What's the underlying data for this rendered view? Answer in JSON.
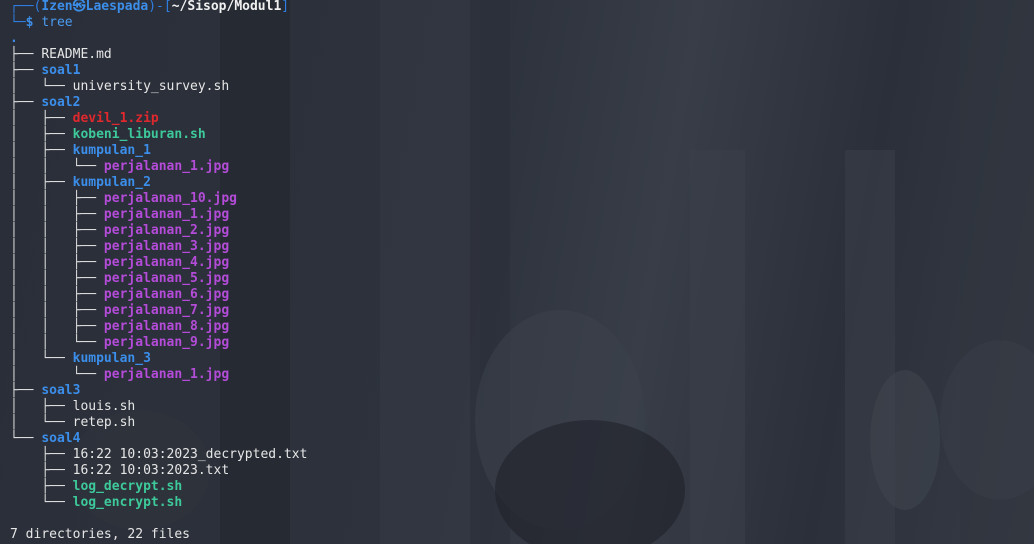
{
  "prompt": {
    "frame_top": "┌──(",
    "user": "Izen㉿Laespada",
    "mid": ")-[",
    "path": "~/Sisop/Modul1",
    "end": "]",
    "frame_bottom": "└─",
    "dollar": "$",
    "command": "tree"
  },
  "tree_root": ".",
  "entries": [
    {
      "prefix": "├── ",
      "name": "README.md",
      "type": "file"
    },
    {
      "prefix": "├── ",
      "name": "soal1",
      "type": "dir"
    },
    {
      "prefix": "│   └── ",
      "name": "university_survey.sh",
      "type": "file"
    },
    {
      "prefix": "├── ",
      "name": "soal2",
      "type": "dir"
    },
    {
      "prefix": "│   ├── ",
      "name": "devil_1.zip",
      "type": "zip"
    },
    {
      "prefix": "│   ├── ",
      "name": "kobeni_liburan.sh",
      "type": "exec"
    },
    {
      "prefix": "│   ├── ",
      "name": "kumpulan_1",
      "type": "dir"
    },
    {
      "prefix": "│   │   └── ",
      "name": "perjalanan_1.jpg",
      "type": "image"
    },
    {
      "prefix": "│   ├── ",
      "name": "kumpulan_2",
      "type": "dir"
    },
    {
      "prefix": "│   │   ├── ",
      "name": "perjalanan_10.jpg",
      "type": "image"
    },
    {
      "prefix": "│   │   ├── ",
      "name": "perjalanan_1.jpg",
      "type": "image"
    },
    {
      "prefix": "│   │   ├── ",
      "name": "perjalanan_2.jpg",
      "type": "image"
    },
    {
      "prefix": "│   │   ├── ",
      "name": "perjalanan_3.jpg",
      "type": "image"
    },
    {
      "prefix": "│   │   ├── ",
      "name": "perjalanan_4.jpg",
      "type": "image"
    },
    {
      "prefix": "│   │   ├── ",
      "name": "perjalanan_5.jpg",
      "type": "image"
    },
    {
      "prefix": "│   │   ├── ",
      "name": "perjalanan_6.jpg",
      "type": "image"
    },
    {
      "prefix": "│   │   ├── ",
      "name": "perjalanan_7.jpg",
      "type": "image"
    },
    {
      "prefix": "│   │   ├── ",
      "name": "perjalanan_8.jpg",
      "type": "image"
    },
    {
      "prefix": "│   │   └── ",
      "name": "perjalanan_9.jpg",
      "type": "image"
    },
    {
      "prefix": "│   └── ",
      "name": "kumpulan_3",
      "type": "dir"
    },
    {
      "prefix": "│       └── ",
      "name": "perjalanan_1.jpg",
      "type": "image"
    },
    {
      "prefix": "├── ",
      "name": "soal3",
      "type": "dir"
    },
    {
      "prefix": "│   ├── ",
      "name": "louis.sh",
      "type": "file"
    },
    {
      "prefix": "│   └── ",
      "name": "retep.sh",
      "type": "file"
    },
    {
      "prefix": "└── ",
      "name": "soal4",
      "type": "dir"
    },
    {
      "prefix": "    ├── ",
      "name": "16:22 10:03:2023_decrypted.txt",
      "type": "file"
    },
    {
      "prefix": "    ├── ",
      "name": "16:22 10:03:2023.txt",
      "type": "file"
    },
    {
      "prefix": "    ├── ",
      "name": "log_decrypt.sh",
      "type": "exec"
    },
    {
      "prefix": "    └── ",
      "name": "log_encrypt.sh",
      "type": "exec"
    }
  ],
  "summary": "7 directories, 22 files",
  "colors": {
    "prompt_frame": "#2f7de0",
    "directory": "#3b8eea",
    "zip": "#e0282d",
    "executable": "#3ec99a",
    "image": "#b44cd9",
    "plain_file": "#e6e6e6"
  }
}
